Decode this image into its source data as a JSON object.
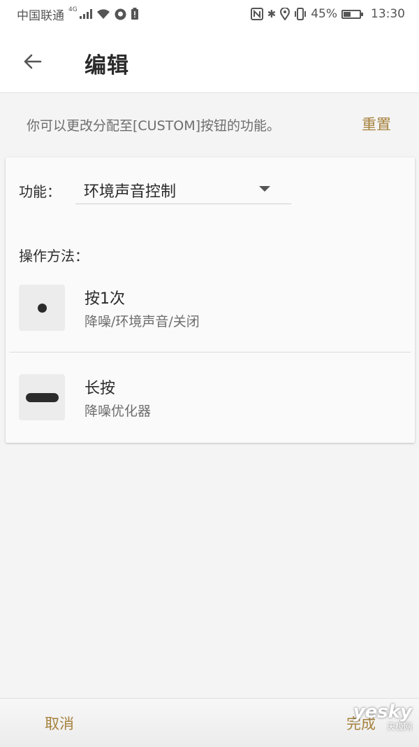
{
  "status_bar": {
    "carrier": "中国联通",
    "network_type": "4G",
    "battery_percent": "45%",
    "battery_level": 0.45,
    "time": "13:30",
    "icons": [
      "signal-icon",
      "wifi-icon",
      "notification-icon",
      "alert-icon",
      "nfc-icon",
      "bluetooth-icon",
      "location-icon",
      "vibrate-icon",
      "battery-icon"
    ]
  },
  "header": {
    "title": "编辑",
    "back_icon": "back-arrow-icon"
  },
  "info": {
    "text": "你可以更改分配至[CUSTOM]按钮的功能。",
    "reset_label": "重置"
  },
  "function": {
    "label": "功能：",
    "selected": "环境声音控制"
  },
  "operation": {
    "label": "操作方法：",
    "items": [
      {
        "icon": "single-press-dot-icon",
        "title": "按1次",
        "description": "降噪/环境声音/关闭"
      },
      {
        "icon": "long-press-bar-icon",
        "title": "长按",
        "description": "降噪优化器"
      }
    ]
  },
  "footer": {
    "cancel_label": "取消",
    "done_label": "完成",
    "watermark_main": "yesky",
    "watermark_sub": "天极网"
  },
  "colors": {
    "accent": "#a6823d",
    "background": "#f4f4f4",
    "card": "#fafafa"
  }
}
